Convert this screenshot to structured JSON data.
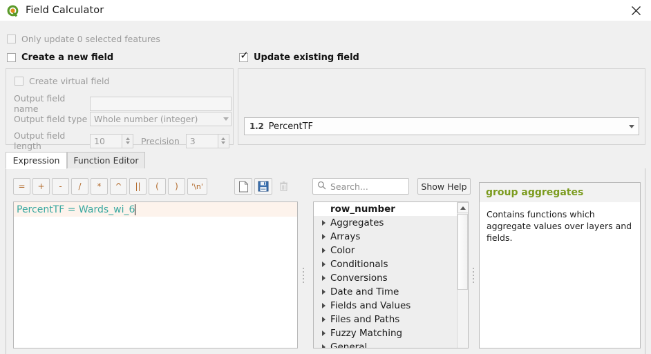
{
  "window": {
    "title": "Field Calculator",
    "logo_icon": "qgis-logo-icon",
    "close_icon": "close-icon"
  },
  "options": {
    "only_update_selected_label": "Only update 0 selected features",
    "only_update_selected_checked": false,
    "create_new_field_label": "Create a new field",
    "create_new_field_checked": false,
    "update_existing_field_label": "Update existing field",
    "update_existing_field_checked": true,
    "checkmark_glyph": "✓"
  },
  "new_field": {
    "create_virtual_label": "Create virtual field",
    "create_virtual_checked": false,
    "output_name_label": "Output field name",
    "output_name_value": "",
    "output_type_label": "Output field type",
    "output_type_value": "Whole number (integer)",
    "output_length_label": "Output field length",
    "output_length_value": "10",
    "precision_label": "Precision",
    "precision_value": "3"
  },
  "existing_field": {
    "type_badge": "1.2",
    "field_name": "PercentTF",
    "dropdown_icon": "chevron-down-icon"
  },
  "tabs": [
    {
      "label": "Expression",
      "active": true
    },
    {
      "label": "Function Editor",
      "active": false
    }
  ],
  "operators": [
    "=",
    "+",
    "-",
    "/",
    "*",
    "^",
    "||",
    "(",
    ")",
    "'\\n'"
  ],
  "file_actions": [
    {
      "name": "new-expression-button",
      "icon": "new-document-icon",
      "enabled": true
    },
    {
      "name": "save-expression-button",
      "icon": "save-floppy-icon",
      "enabled": true
    },
    {
      "name": "delete-expression-button",
      "icon": "trash-icon",
      "enabled": false
    }
  ],
  "search": {
    "placeholder": "Search...",
    "value": "",
    "icon": "search-icon"
  },
  "help_button_label": "Show Help",
  "expression": {
    "text": "PercentTF = Wards_wi_6"
  },
  "function_tree": [
    {
      "label": "row_number",
      "expandable": false,
      "selected": true
    },
    {
      "label": "Aggregates",
      "expandable": true,
      "selected": false
    },
    {
      "label": "Arrays",
      "expandable": true,
      "selected": false
    },
    {
      "label": "Color",
      "expandable": true,
      "selected": false
    },
    {
      "label": "Conditionals",
      "expandable": true,
      "selected": false
    },
    {
      "label": "Conversions",
      "expandable": true,
      "selected": false
    },
    {
      "label": "Date and Time",
      "expandable": true,
      "selected": false
    },
    {
      "label": "Fields and Values",
      "expandable": true,
      "selected": false
    },
    {
      "label": "Files and Paths",
      "expandable": true,
      "selected": false
    },
    {
      "label": "Fuzzy Matching",
      "expandable": true,
      "selected": false
    },
    {
      "label": "General",
      "expandable": true,
      "selected": false
    }
  ],
  "help": {
    "title": "group aggregates",
    "body": "Contains functions which aggregate values over layers and fields.",
    "title_color": "#7b9b1e"
  }
}
